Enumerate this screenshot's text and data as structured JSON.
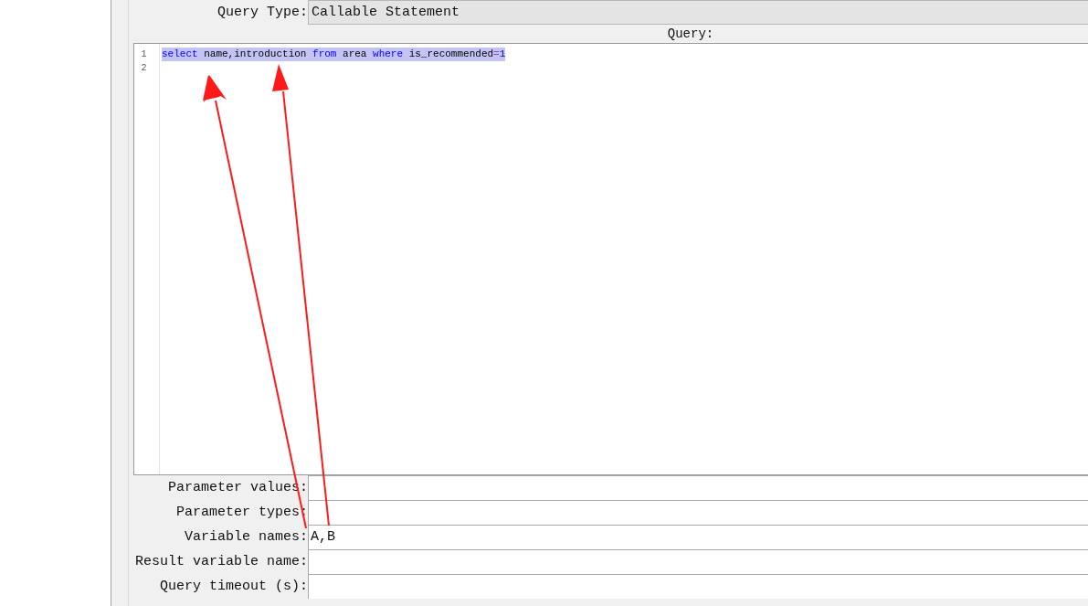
{
  "query_type": {
    "label": "Query Type:",
    "value": "Callable Statement"
  },
  "query": {
    "label": "Query:",
    "lines": [
      {
        "number": "1",
        "selected": true,
        "tokens": [
          {
            "text": "select",
            "kind": "keyword"
          },
          {
            "text": " name,introduction ",
            "kind": "plain"
          },
          {
            "text": "from",
            "kind": "keyword"
          },
          {
            "text": " area ",
            "kind": "plain"
          },
          {
            "text": "where",
            "kind": "keyword"
          },
          {
            "text": " is_recommended",
            "kind": "plain"
          },
          {
            "text": "=",
            "kind": "operator"
          },
          {
            "text": "1",
            "kind": "number"
          }
        ]
      },
      {
        "number": "2",
        "selected": false
      }
    ]
  },
  "fields": [
    {
      "label": "Parameter values:"
    },
    {
      "label": "Parameter types:"
    },
    {
      "label": "Variable names:",
      "value": "A,B"
    },
    {
      "label": "Result variable name:"
    },
    {
      "label": "Query timeout (s):"
    }
  ]
}
